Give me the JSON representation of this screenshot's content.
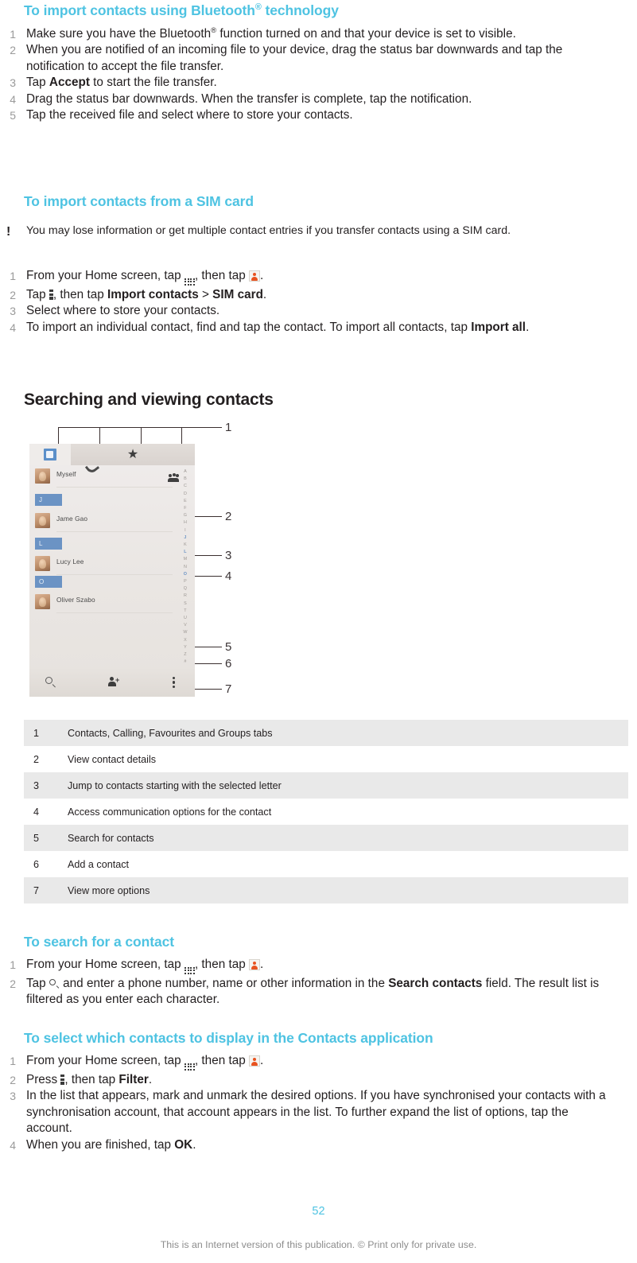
{
  "colors": {
    "heading": "#4ec3e2",
    "body_text": "#231f20",
    "step_number": "#9a9a9a",
    "table_stripe": "#e9e9e9",
    "accent_orange": "#e8521f",
    "accent_blue": "#6b93c4"
  },
  "sections": [
    {
      "heading_pre": "To import contacts using Bluetooth",
      "heading_sup": "®",
      "heading_post": " technology",
      "steps": [
        "Make sure you have the Bluetooth® function turned on and that your device is set to visible.",
        "When you are notified of an incoming file to your device, drag the status bar downwards and tap the notification to accept the file transfer.",
        "Tap Accept to start the file transfer.",
        "Drag the status bar downwards. When the transfer is complete, tap the notification.",
        "Tap the received file and select where to store your contacts."
      ]
    },
    {
      "heading": "To import contacts from a SIM card",
      "note": "You may lose information or get multiple contact entries if you transfer contacts using a SIM card.",
      "note_icon": "exclamation-icon",
      "steps": [
        "From your Home screen, tap [grid-icon], then tap [contacts-app-icon].",
        "Tap [overflow-menu-icon], then tap Import contacts > SIM card.",
        "Select where to store your contacts.",
        "To import an individual contact, find and tap the contact. To import all contacts, tap Import all."
      ]
    }
  ],
  "big_heading": "Searching and viewing contacts",
  "figure": {
    "tabs": [
      {
        "name": "contacts-tab",
        "icon": "contact-card-icon",
        "active": true
      },
      {
        "name": "calling-tab",
        "icon": "phone-handset-icon",
        "active": false
      },
      {
        "name": "favourites-tab",
        "icon": "star-icon",
        "active": false
      },
      {
        "name": "groups-tab",
        "icon": "group-people-icon",
        "active": false
      }
    ],
    "contacts": [
      {
        "name": "Myself",
        "group_letter": null
      },
      {
        "name": "Jame Gao",
        "group_letter": "J"
      },
      {
        "name": "Lucy Lee",
        "group_letter": "L"
      },
      {
        "name": "Oliver Szabo",
        "group_letter": "O"
      }
    ],
    "index_letters": [
      "A",
      "B",
      "C",
      "D",
      "E",
      "F",
      "G",
      "H",
      "I",
      "J",
      "K",
      "L",
      "M",
      "N",
      "O",
      "P",
      "Q",
      "R",
      "S",
      "T",
      "U",
      "V",
      "W",
      "X",
      "Y",
      "Z",
      "#"
    ],
    "index_highlighted": [
      "J",
      "L",
      "O"
    ],
    "bottom_bar": [
      {
        "name": "search-contacts-icon",
        "label": "search"
      },
      {
        "name": "add-contact-icon",
        "label": "add contact"
      },
      {
        "name": "more-options-icon",
        "label": "more options"
      }
    ],
    "callout_numbers": [
      "1",
      "2",
      "3",
      "4",
      "5",
      "6",
      "7"
    ]
  },
  "legend": {
    "rows": [
      {
        "n": "1",
        "text": "Contacts, Calling, Favourites and Groups tabs"
      },
      {
        "n": "2",
        "text": "View contact details"
      },
      {
        "n": "3",
        "text": "Jump to contacts starting with the selected letter"
      },
      {
        "n": "4",
        "text": "Access communication options for the contact"
      },
      {
        "n": "5",
        "text": "Search for contacts"
      },
      {
        "n": "6",
        "text": "Add a contact"
      },
      {
        "n": "7",
        "text": "View more options"
      }
    ]
  },
  "search_section": {
    "heading": "To search for a contact",
    "step1_a": "From your Home screen, tap ",
    "step1_b": ", then tap ",
    "step1_c": ".",
    "step2_a": "Tap ",
    "step2_b": " and enter a phone number, name or other information in the ",
    "step2_bold": "Search contacts",
    "step2_c": " field. The result list is filtered as you enter each character."
  },
  "select_section": {
    "heading": "To select which contacts to display in the Contacts application",
    "step1_a": "From your Home screen, tap ",
    "step1_b": ", then tap ",
    "step1_c": ".",
    "step2_a": "Press ",
    "step2_b": ", then tap ",
    "step2_bold": "Filter",
    "step2_c": ".",
    "step3": "In the list that appears, mark and unmark the desired options. If you have synchronised your contacts with a synchronisation account, that account appears in the list. To further expand the list of options, tap the account.",
    "step4_a": "When you are finished, tap ",
    "step4_bold": "OK",
    "step4_c": "."
  },
  "bluetooth_steps_rich": {
    "s1_a": "Make sure you have the Bluetooth",
    "s1_sup": "®",
    "s1_b": " function turned on and that your device is set to visible.",
    "s2": "When you are notified of an incoming file to your device, drag the status bar downwards and tap the notification to accept the file transfer.",
    "s3_a": "Tap ",
    "s3_bold": "Accept",
    "s3_b": " to start the file transfer.",
    "s4": "Drag the status bar downwards. When the transfer is complete, tap the notification.",
    "s5": "Tap the received file and select where to store your contacts."
  },
  "sim_steps_rich": {
    "s1_a": "From your Home screen, tap ",
    "s1_b": ", then tap ",
    "s1_c": ".",
    "s2_a": "Tap ",
    "s2_b": ", then tap ",
    "s2_bold1": "Import contacts",
    "s2_gt": " > ",
    "s2_bold2": "SIM card",
    "s2_c": ".",
    "s3": "Select where to store your contacts.",
    "s4_a": "To import an individual contact, find and tap the contact. To import all contacts, tap ",
    "s4_bold": "Import all",
    "s4_c": "."
  },
  "note_text": "You may lose information or get multiple contact entries if you transfer contacts using a SIM card.",
  "page_number": "52",
  "footer_text": "This is an Internet version of this publication. © Print only for private use."
}
